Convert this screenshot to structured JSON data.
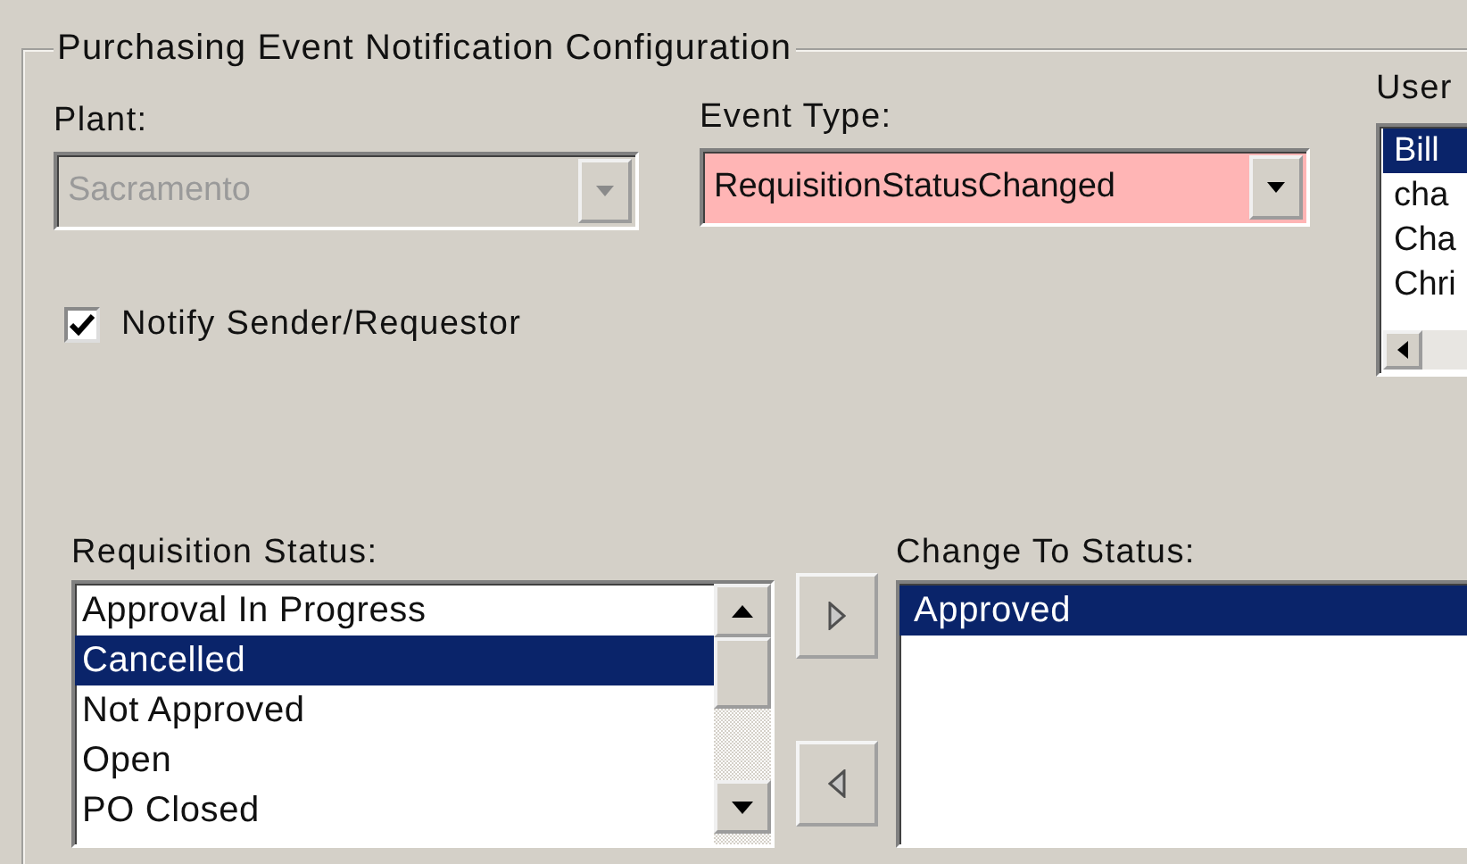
{
  "group": {
    "title": "Purchasing Event Notification Configuration"
  },
  "plant": {
    "label": "Plant:",
    "value": "Sacramento",
    "disabled": true,
    "highlighted": false
  },
  "event_type": {
    "label": "Event Type:",
    "value": "RequisitionStatusChanged",
    "disabled": false,
    "highlighted": true
  },
  "users": {
    "label": "User",
    "items": [
      {
        "label": "Bill",
        "selected": true
      },
      {
        "label": "cha",
        "selected": false
      },
      {
        "label": "Cha",
        "selected": false
      },
      {
        "label": "Chri",
        "selected": false
      }
    ]
  },
  "notify": {
    "label": "Notify Sender/Requestor",
    "checked": true
  },
  "requisition_status": {
    "label": "Requisition Status:",
    "items": [
      {
        "label": "Approval In Progress",
        "selected": false
      },
      {
        "label": "Cancelled",
        "selected": true
      },
      {
        "label": "Not Approved",
        "selected": false
      },
      {
        "label": "Open",
        "selected": false
      },
      {
        "label": "PO Closed",
        "selected": false
      }
    ]
  },
  "change_to_status": {
    "label": "Change To Status:",
    "items": [
      {
        "label": "Approved",
        "selected": true
      }
    ]
  }
}
